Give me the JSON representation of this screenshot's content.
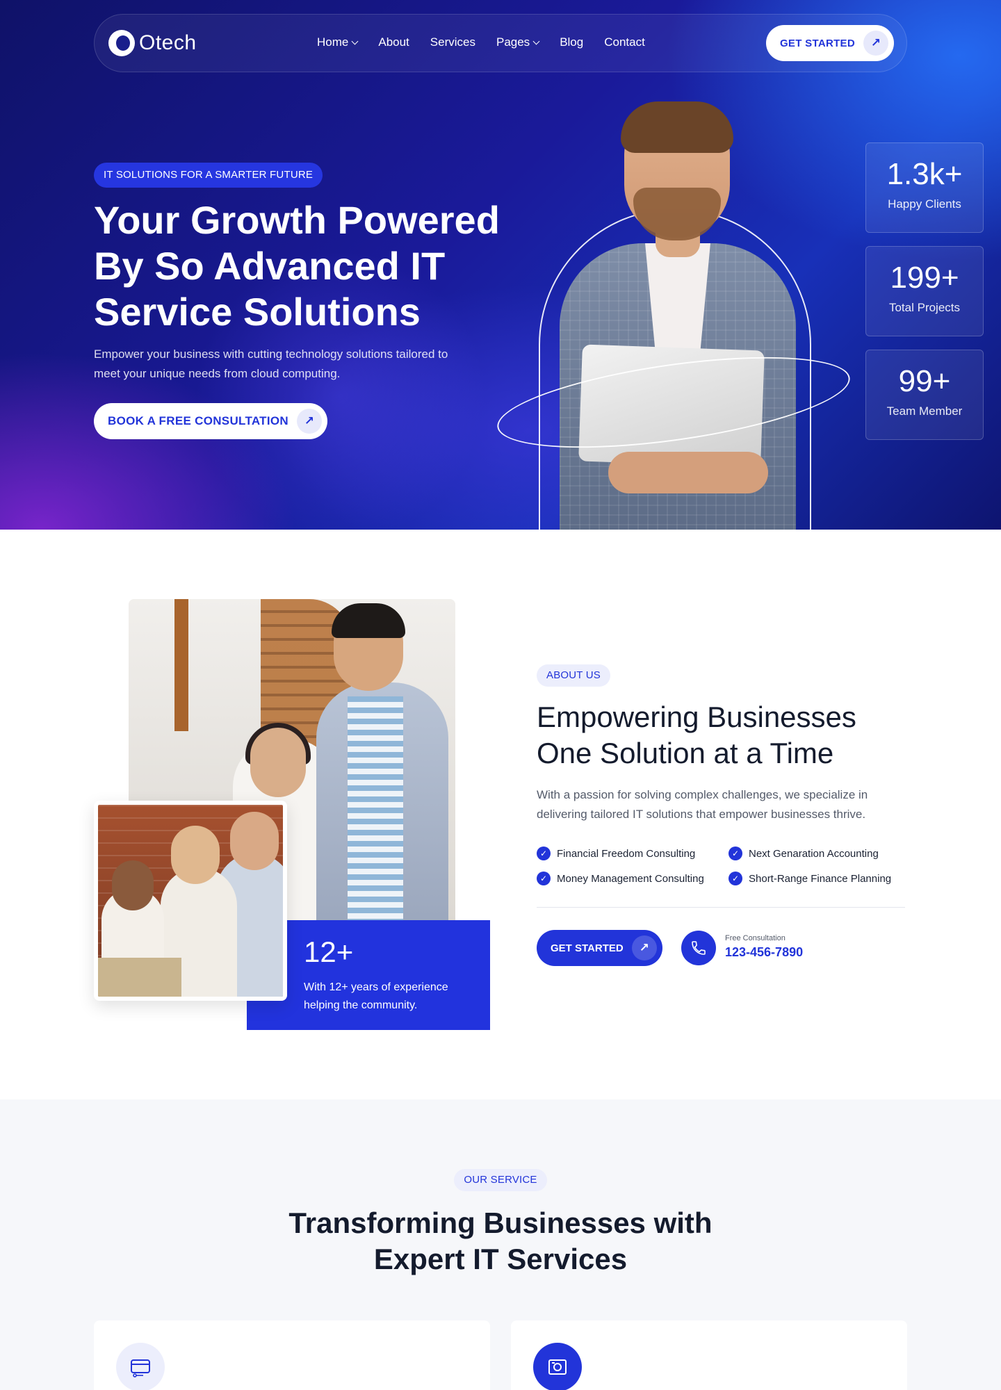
{
  "nav": {
    "logo_text": "Otech",
    "links": [
      {
        "label": "Home",
        "dropdown": true
      },
      {
        "label": "About",
        "dropdown": false
      },
      {
        "label": "Services",
        "dropdown": false
      },
      {
        "label": "Pages",
        "dropdown": true
      },
      {
        "label": "Blog",
        "dropdown": false
      },
      {
        "label": "Contact",
        "dropdown": false
      }
    ],
    "cta_label": "GET STARTED"
  },
  "hero": {
    "badge": "IT SOLUTIONS FOR A SMARTER FUTURE",
    "title": "Your Growth Powered By So Advanced IT Service Solutions",
    "text": "Empower your business with cutting technology solutions tailored to meet your unique needs from cloud computing.",
    "cta_label": "BOOK A FREE CONSULTATION",
    "stats": [
      {
        "value": "1.3k+",
        "label": "Happy Clients"
      },
      {
        "value": "199+",
        "label": "Total Projects"
      },
      {
        "value": "99+",
        "label": "Team Member"
      }
    ]
  },
  "about": {
    "tag": "ABOUT US",
    "title": "Empowering Businesses One Solution at a Time",
    "text": "With a passion for solving complex challenges, we specialize in delivering tailored IT solutions that empower businesses thrive.",
    "features": [
      "Financial Freedom Consulting",
      "Next Genaration Accounting",
      "Money Management Consulting",
      "Short-Range Finance Planning"
    ],
    "experience_value": "12+",
    "experience_text": "With 12+ years of experience helping the community.",
    "cta_label": "GET STARTED",
    "phone_label": "Free Consultation",
    "phone_number": "123-456-7890"
  },
  "services": {
    "tag": "OUR SERVICE",
    "title": "Transforming Businesses with Expert IT Services",
    "cards": [
      {
        "icon": "payment-card-icon"
      },
      {
        "icon": "video-monitor-icon"
      }
    ]
  },
  "colors": {
    "primary": "#2234d9",
    "hero_dark": "#0f1268",
    "light_tag": "#eceefc"
  }
}
